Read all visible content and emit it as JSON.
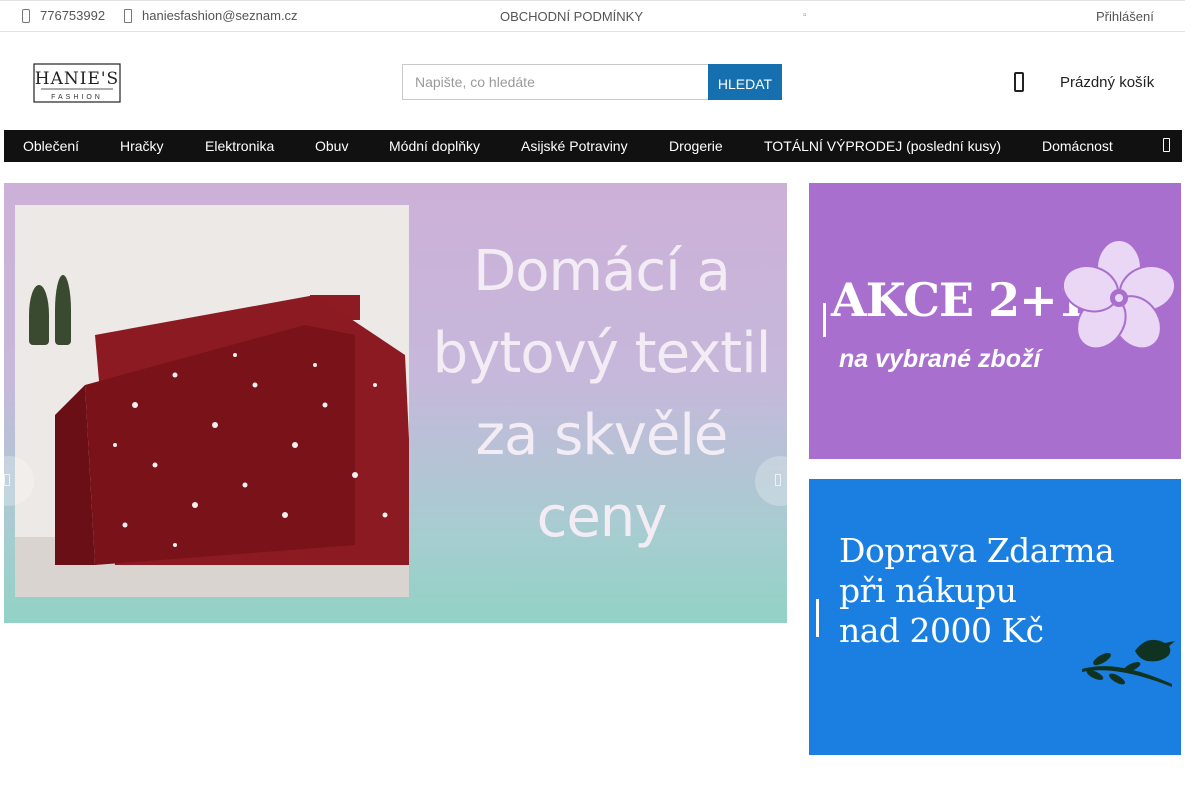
{
  "topbar": {
    "phone": "776753992",
    "email": "haniesfashion@seznam.cz",
    "terms": "OBCHODNÍ PODMÍNKY",
    "lang_icon": "",
    "login": "Přihlášení"
  },
  "logo": {
    "name": "HANIE'S",
    "tagline": "FASHION"
  },
  "search": {
    "placeholder": "Napište, co hledáte",
    "button": "HLEDAT"
  },
  "cart": {
    "label": "Prázdný košík"
  },
  "nav": {
    "items": [
      "Oblečení",
      "Hračky",
      "Elektronika",
      "Obuv",
      "Módní doplňky",
      "Asijské Potraviny",
      "Drogerie",
      "TOTÁLNÍ VÝPRODEJ (poslední kusy)",
      "Domácnost"
    ]
  },
  "slider": {
    "lines": [
      "Domácí a",
      "bytový textil",
      "za skvělé",
      "ceny"
    ]
  },
  "banners": {
    "akce": {
      "title": "AKCE 2+1",
      "subtitle": "na vybrané zboží"
    },
    "doprava": {
      "lines": [
        "Doprava Zdarma",
        "při nákupu",
        "nad 2000 Kč"
      ]
    }
  },
  "colors": {
    "nav_bg": "#111111",
    "search_button": "#166fae",
    "akce_bg": "#a96fce",
    "doprava_bg": "#1a7fe0"
  },
  "icons": [
    "phone-icon",
    "mail-icon",
    "globe-icon",
    "cart-icon",
    "menu-more-icon",
    "arrow-left-icon",
    "arrow-right-icon"
  ]
}
